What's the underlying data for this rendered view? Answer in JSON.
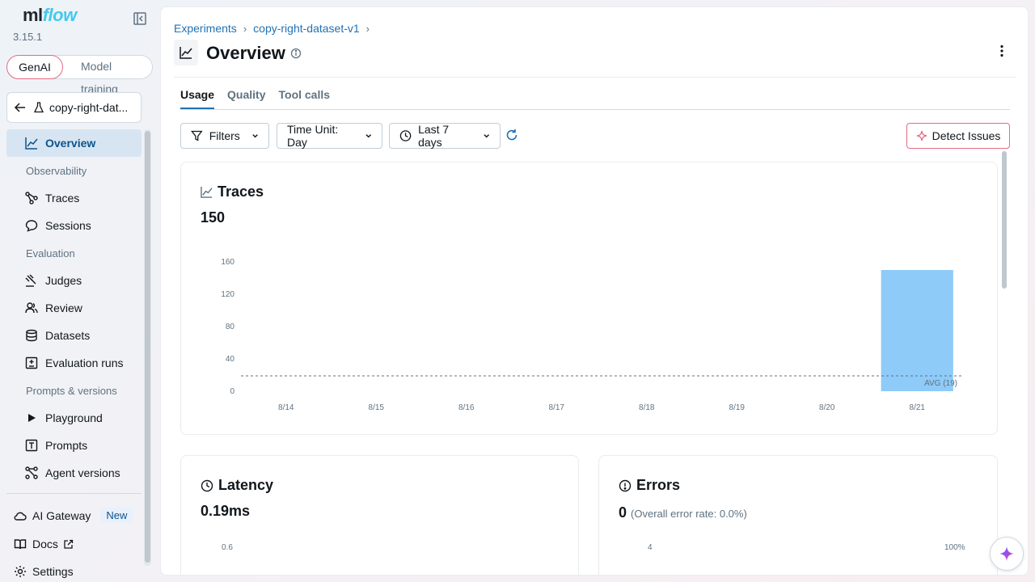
{
  "app": {
    "logo_ml": "ml",
    "logo_flow": "flow",
    "version": "3.15.1"
  },
  "mode_toggle": {
    "genai": "GenAI",
    "model_training": "Model training"
  },
  "experiment_selector": {
    "label": "copy-right-dat..."
  },
  "sidebar": {
    "overview": "Overview",
    "section_observability": "Observability",
    "traces": "Traces",
    "sessions": "Sessions",
    "section_evaluation": "Evaluation",
    "judges": "Judges",
    "review": "Review",
    "datasets": "Datasets",
    "evaluation_runs": "Evaluation runs",
    "section_prompts": "Prompts & versions",
    "playground": "Playground",
    "prompts": "Prompts",
    "agent_versions": "Agent versions",
    "ai_gateway": "AI Gateway",
    "ai_gateway_badge": "New",
    "docs": "Docs",
    "settings": "Settings"
  },
  "breadcrumb": {
    "experiments": "Experiments",
    "dataset": "copy-right-dataset-v1",
    "sep": "›"
  },
  "page": {
    "title": "Overview"
  },
  "tabs": {
    "usage": "Usage",
    "quality": "Quality",
    "tool_calls": "Tool calls"
  },
  "toolbar": {
    "filters": "Filters",
    "time_unit": "Time Unit: Day",
    "time_range": "Last 7 days",
    "detect_issues": "Detect Issues"
  },
  "colors": {
    "accent": "#2272b4",
    "bar": "#8fcbf9",
    "ai_accent": "#e46b84"
  },
  "traces_card": {
    "title": "Traces",
    "value": "150",
    "chart_data": {
      "type": "bar",
      "categories": [
        "8/14",
        "8/15",
        "8/16",
        "8/17",
        "8/18",
        "8/19",
        "8/20",
        "8/21"
      ],
      "values": [
        0,
        0,
        0,
        0,
        0,
        0,
        0,
        150
      ],
      "y_ticks": [
        "0",
        "40",
        "80",
        "120",
        "160"
      ],
      "ylim": [
        0,
        160
      ],
      "avg_value": 19,
      "avg_label": "AVG (19)"
    }
  },
  "latency_card": {
    "title": "Latency",
    "value": "0.19ms",
    "y_tick_top": "0.6"
  },
  "errors_card": {
    "title": "Errors",
    "value": "0",
    "subtitle": "(Overall error rate: 0.0%)",
    "y_tick_left": "4",
    "y_tick_right": "100%"
  }
}
